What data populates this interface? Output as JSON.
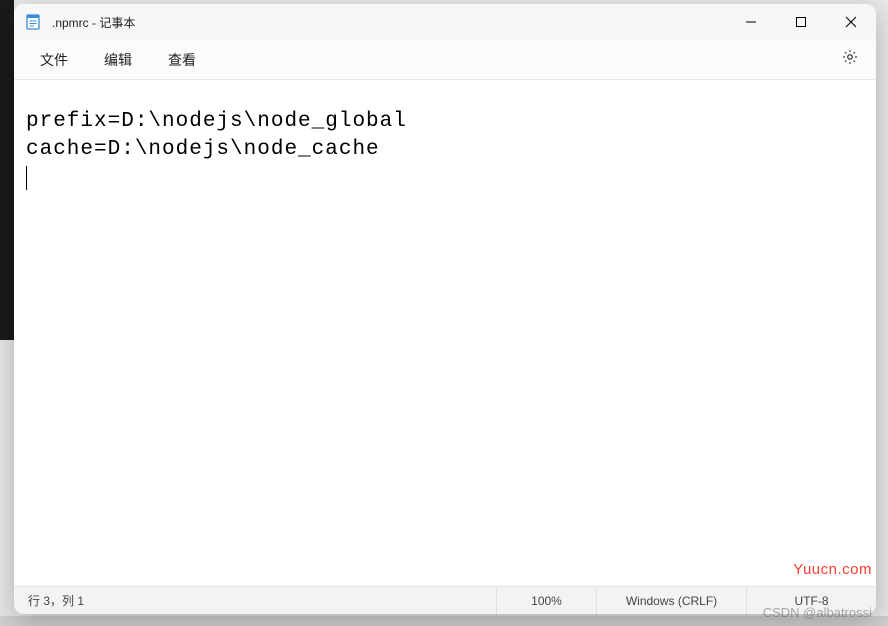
{
  "titlebar": {
    "title": ".npmrc - 记事本"
  },
  "menubar": {
    "file": "文件",
    "edit": "编辑",
    "view": "查看"
  },
  "editor": {
    "line1": "prefix=D:\\nodejs\\node_global",
    "line2": "cache=D:\\nodejs\\node_cache"
  },
  "statusbar": {
    "position": "行 3，列 1",
    "zoom": "100%",
    "eol": "Windows (CRLF)",
    "encoding": "UTF-8"
  },
  "watermarks": {
    "site": "Yuucn.com",
    "author": "CSDN @albatrossi"
  }
}
